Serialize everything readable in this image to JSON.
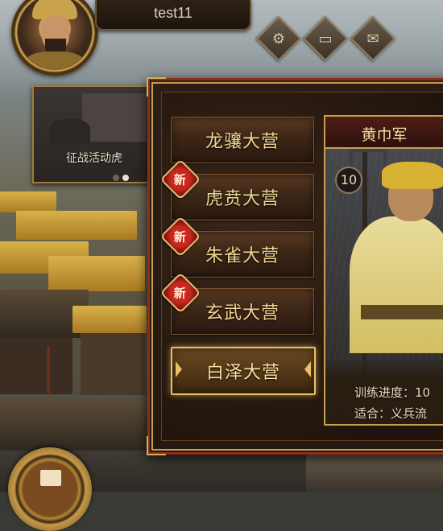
{
  "player": {
    "name": "test11"
  },
  "top_buttons": [
    {
      "icon": "gear-icon"
    },
    {
      "icon": "chest-icon"
    },
    {
      "icon": "mail-icon"
    }
  ],
  "event_banner": {
    "label": "征战活动虎",
    "page_count": 2,
    "active_page": 2
  },
  "camps": [
    {
      "label": "龙骧大营",
      "new": false,
      "selected": false
    },
    {
      "label": "虎贲大营",
      "new": true,
      "selected": false
    },
    {
      "label": "朱雀大营",
      "new": true,
      "selected": false
    },
    {
      "label": "玄武大营",
      "new": true,
      "selected": false
    },
    {
      "label": "白泽大营",
      "new": false,
      "selected": true
    }
  ],
  "new_badge_text": "新",
  "army_card": {
    "title": "黄巾军",
    "level": "10",
    "training_progress": "训练进度：10",
    "suitable_for": "适合：义兵流"
  },
  "colors": {
    "accent_gold": "#c9a052",
    "frame_red": "#8e2e1e",
    "badge_red": "#c8281e"
  }
}
